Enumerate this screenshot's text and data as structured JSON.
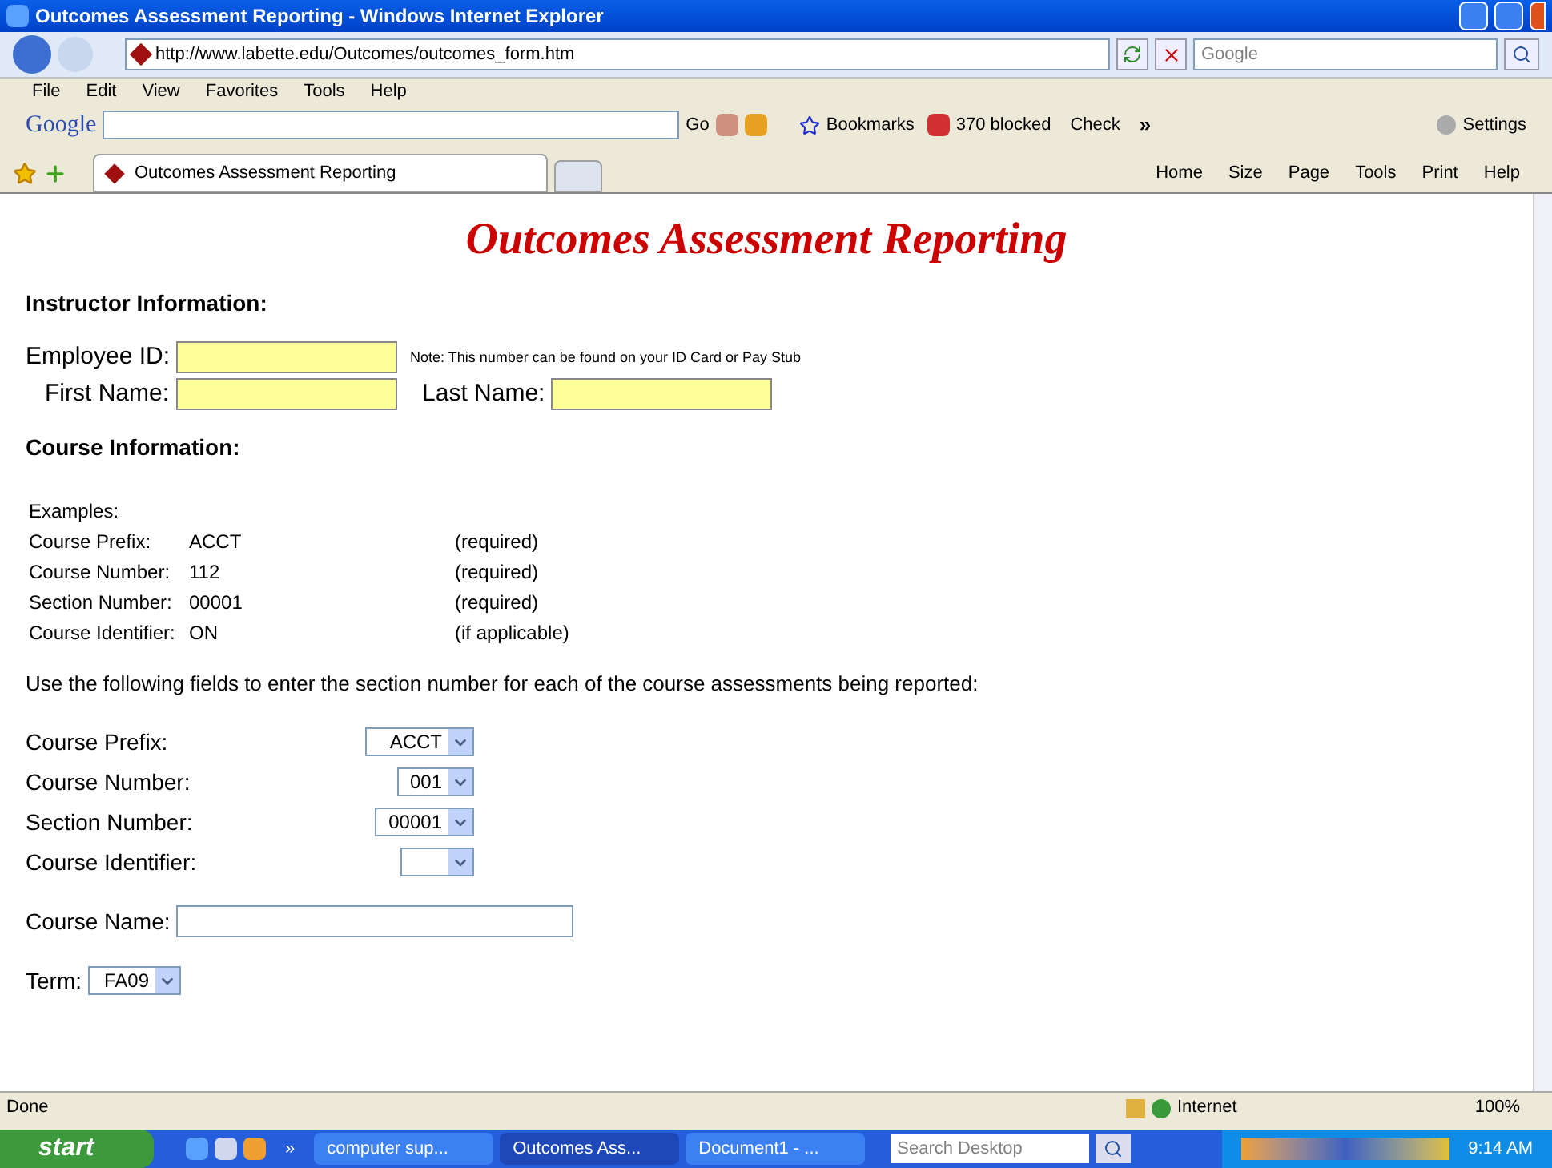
{
  "window": {
    "title": "Outcomes Assessment Reporting - Windows Internet Explorer"
  },
  "address": {
    "value": "http://www.labette.edu/Outcomes/outcomes_form.htm"
  },
  "search": {
    "placeholder": "Google"
  },
  "menu": [
    "File",
    "Edit",
    "View",
    "Favorites",
    "Tools",
    "Help"
  ],
  "google_toolbar": {
    "logo": "Google",
    "go": "Go",
    "bookmarks": "Bookmarks",
    "blocked": "370 blocked",
    "check": "Check",
    "more": "»",
    "settings": "Settings"
  },
  "tabs": [
    {
      "label": "Outcomes Assessment Reporting",
      "selected": true
    }
  ],
  "command_bar": [
    "Home",
    "Size",
    "Page",
    "Tools",
    "Print",
    "Help"
  ],
  "page": {
    "heading": "Outcomes Assessment Reporting",
    "instructor_heading": "Instructor Information:",
    "employee_id_label": "Employee ID:",
    "note": "Note: This number can be found on your ID Card or Pay Stub",
    "first_name_label": "First Name:",
    "last_name_label": "Last Name:",
    "course_heading": "Course Information:",
    "examples_label": "Examples:",
    "examples": [
      {
        "label": "Course Prefix:",
        "value": "ACCT",
        "note": "(required)"
      },
      {
        "label": "Course Number:",
        "value": "112",
        "note": "(required)"
      },
      {
        "label": "Section Number:",
        "value": "00001",
        "note": "(required)"
      },
      {
        "label": "Course Identifier:",
        "value": "ON",
        "note": "(if applicable)"
      }
    ],
    "instructions": "Use the following fields to enter the section number for each of the course assessments being reported:",
    "selects": [
      {
        "label": "Course Prefix:",
        "value": "ACCT"
      },
      {
        "label": "Course Number:",
        "value": "001"
      },
      {
        "label": "Section Number:",
        "value": "00001"
      },
      {
        "label": "Course Identifier:"
      }
    ],
    "course_name_label": "Course Name:",
    "term_label": "Term:",
    "term_value": "FA09"
  },
  "status_bar": {
    "text": "Done",
    "zone": "Internet",
    "zoom": "100%"
  },
  "taskbar": {
    "start": "start",
    "items": [
      {
        "label": "computer sup...",
        "selected": false
      },
      {
        "label": "Outcomes Ass...",
        "selected": true
      },
      {
        "label": "Document1 - ...",
        "selected": false
      }
    ],
    "more": "»",
    "search_placeholder": "Search Desktop",
    "clock": "9:14 AM"
  }
}
